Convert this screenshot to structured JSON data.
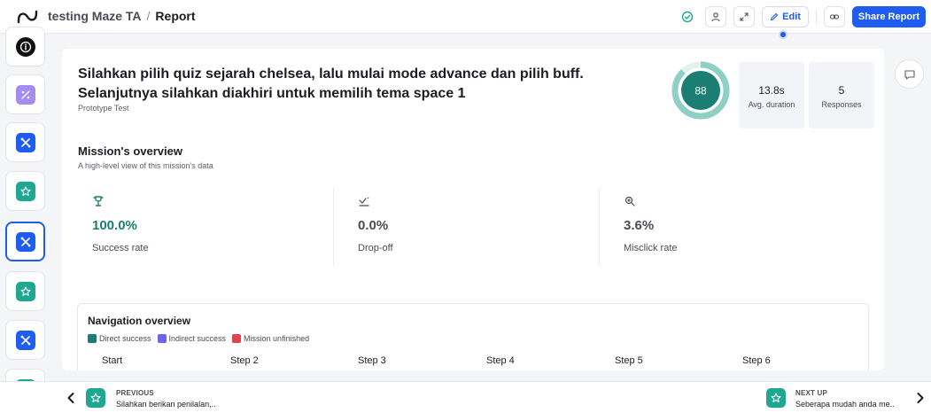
{
  "header": {
    "logo_icon": "maze-logo-icon",
    "project_name": "testing Maze TA",
    "separator": "/",
    "page_name": "Report",
    "edit_label": "Edit",
    "share_label": "Share Report"
  },
  "sidebar": {
    "items": [
      {
        "icon": "info-icon",
        "color": "#111111"
      },
      {
        "icon": "percent-icon",
        "color": "#a58cf3"
      },
      {
        "icon": "mission-icon",
        "color": "#1f5df0"
      },
      {
        "icon": "star-icon",
        "color": "#1ea891"
      },
      {
        "icon": "mission-icon",
        "color": "#1f5df0",
        "active": true
      },
      {
        "icon": "star-icon",
        "color": "#1ea891"
      },
      {
        "icon": "mission-icon",
        "color": "#1f5df0"
      },
      {
        "icon": "star-icon",
        "color": "#1ea891"
      }
    ]
  },
  "block": {
    "title": "Silahkan pilih quiz sejarah chelsea, lalu mulai mode advance dan pilih buff. Selanjutnya silahkan diakhiri untuk memilih tema space 1",
    "type": "Prototype Test",
    "score": "88",
    "score_fraction": 0.88,
    "stats": [
      {
        "value": "13.8s",
        "label": "Avg. duration"
      },
      {
        "value": "5",
        "label": "Responses"
      }
    ]
  },
  "mission_overview": {
    "title": "Mission's overview",
    "subtitle": "A high-level view of this mission's data",
    "metrics": [
      {
        "icon": "trophy-icon",
        "value": "100.0%",
        "label": "Success rate",
        "color": "#1a7f72"
      },
      {
        "icon": "drop-off-icon",
        "value": "0.0%",
        "label": "Drop-off",
        "color": "#4b4c56"
      },
      {
        "icon": "misclick-icon",
        "value": "3.6%",
        "label": "Misclick rate",
        "color": "#4b4c56"
      }
    ]
  },
  "navigation_overview": {
    "title": "Navigation overview",
    "legend": [
      {
        "label": "Direct success",
        "color": "#1a7f72"
      },
      {
        "label": "Indirect success",
        "color": "#6e63f0"
      },
      {
        "label": "Mission unfinished",
        "color": "#e0434b"
      }
    ],
    "steps": [
      "Start",
      "Step 2",
      "Step 3",
      "Step 4",
      "Step 5",
      "Step 6"
    ]
  },
  "footer": {
    "previous_head": "PREVIOUS",
    "previous_text": "Silahkan berikan penilalan,..",
    "next_head": "NEXT UP",
    "next_text": "Seberapa mudah anda me.."
  },
  "colors": {
    "accent": "#1f5df0",
    "teal": "#1ea891",
    "score_ring": "#8fd0c6",
    "score_fill": "#1a7f72"
  }
}
